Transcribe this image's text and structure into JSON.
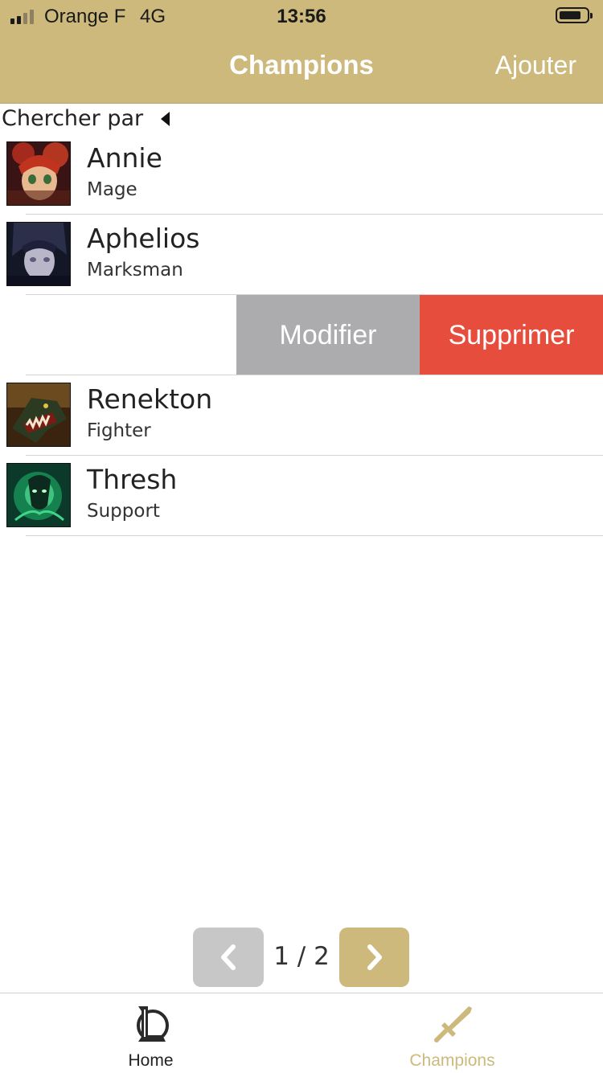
{
  "status_bar": {
    "carrier": "Orange F",
    "network": "4G",
    "time": "13:56",
    "signal_bars": 2,
    "signal_total": 4
  },
  "nav": {
    "title": "Champions",
    "add_label": "Ajouter"
  },
  "search": {
    "label": "Chercher par",
    "caret_icon": "caret-left-icon"
  },
  "champions": [
    {
      "name": "Annie",
      "role": "Mage",
      "portrait_icon": "annie-portrait"
    },
    {
      "name": "Aphelios",
      "role": "Marksman",
      "portrait_icon": "aphelios-portrait"
    },
    {
      "name": "Renekton",
      "role": "Fighter",
      "portrait_icon": "renekton-portrait"
    },
    {
      "name": "Thresh",
      "role": "Support",
      "portrait_icon": "thresh-portrait"
    }
  ],
  "swipe_actions": {
    "modify_label": "Modifier",
    "delete_label": "Supprimer",
    "modify_color": "#acacae",
    "delete_color": "#e64d3d"
  },
  "pagination": {
    "label": "1 / 2",
    "prev_icon": "chevron-left-icon",
    "next_icon": "chevron-right-icon"
  },
  "tabs": [
    {
      "label": "Home",
      "icon": "league-logo-icon",
      "active": false
    },
    {
      "label": "Champions",
      "icon": "sword-icon",
      "active": true
    }
  ],
  "colors": {
    "accent": "#cdb97c",
    "danger": "#e64d3d",
    "disabled": "#c7c7c7"
  }
}
